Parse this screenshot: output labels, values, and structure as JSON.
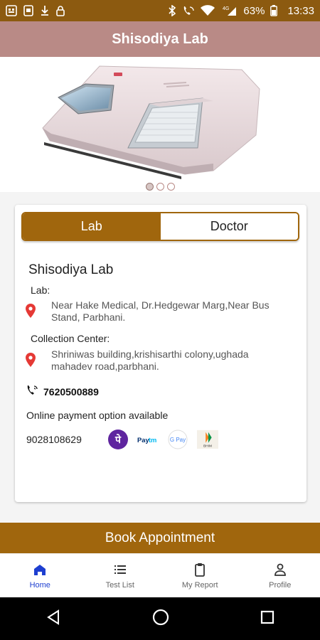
{
  "status_bar": {
    "battery": "63%",
    "time": "13:33",
    "network": "4G"
  },
  "app_bar": {
    "title": "Shisodiya Lab"
  },
  "carousel": {
    "dots": 3,
    "active_index": 0
  },
  "tabs": [
    {
      "label": "Lab",
      "active": true
    },
    {
      "label": "Doctor",
      "active": false
    }
  ],
  "lab": {
    "name": "Shisodiya Lab",
    "lab_label": "Lab:",
    "lab_address": "Near Hake Medical, Dr.Hedgewar Marg,Near Bus Stand, Parbhani.",
    "collection_label": "Collection Center:",
    "collection_address": "Shriniwas building,krishisarthi colony,ughada mahadev road,parbhani.",
    "phone": "7620500889",
    "payment_text": "Online payment option available",
    "payment_number": "9028108629",
    "payment_icons": [
      "phonepe-icon",
      "paytm-icon",
      "gpay-icon",
      "bhim-icon"
    ]
  },
  "book_button": {
    "label": "Book Appointment"
  },
  "bottom_nav": [
    {
      "label": "Home",
      "icon": "home-icon",
      "active": true
    },
    {
      "label": "Test List",
      "icon": "list-icon",
      "active": false
    },
    {
      "label": "My Report",
      "icon": "clipboard-icon",
      "active": false
    },
    {
      "label": "Profile",
      "icon": "person-icon",
      "active": false
    }
  ],
  "colors": {
    "status_bar": "#8c5a10",
    "app_bar": "#b98a86",
    "accent": "#a0660d",
    "nav_active": "#1e3fd0",
    "pin": "#e53935"
  }
}
